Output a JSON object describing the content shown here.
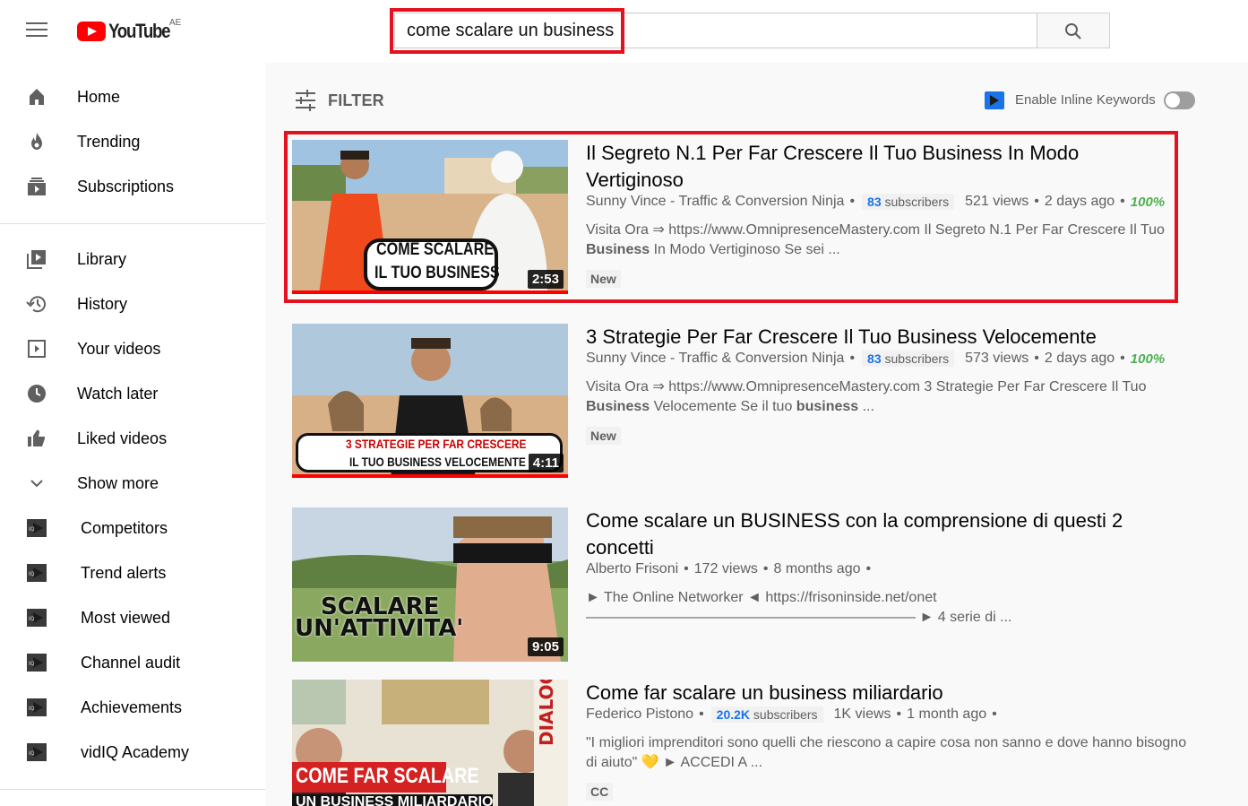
{
  "header": {
    "logo_text": "YouTube",
    "region": "AE",
    "search_query": "come scalare un business"
  },
  "sidebar": {
    "items": [
      {
        "label": "Home",
        "icon": "home-icon"
      },
      {
        "label": "Trending",
        "icon": "trending-icon"
      },
      {
        "label": "Subscriptions",
        "icon": "subscriptions-icon"
      },
      {
        "label": "Library",
        "icon": "library-icon"
      },
      {
        "label": "History",
        "icon": "history-icon"
      },
      {
        "label": "Your videos",
        "icon": "your-videos-icon"
      },
      {
        "label": "Watch later",
        "icon": "watch-later-icon"
      },
      {
        "label": "Liked videos",
        "icon": "liked-videos-icon"
      },
      {
        "label": "Show more",
        "icon": "chevron-down-icon"
      },
      {
        "label": "Competitors",
        "icon": "vidiq-icon"
      },
      {
        "label": "Trend alerts",
        "icon": "vidiq-icon"
      },
      {
        "label": "Most viewed",
        "icon": "vidiq-icon"
      },
      {
        "label": "Channel audit",
        "icon": "vidiq-icon"
      },
      {
        "label": "Achievements",
        "icon": "vidiq-icon"
      },
      {
        "label": "vidIQ Academy",
        "icon": "vidiq-icon"
      }
    ]
  },
  "toolbar": {
    "filter_label": "FILTER",
    "inline_keywords_label": "Enable Inline Keywords"
  },
  "videos": [
    {
      "title": "Il Segreto N.1 Per Far Crescere Il Tuo Business In Modo Vertiginoso",
      "channel": "Sunny Vince - Traffic & Conversion Ninja",
      "subs_count": "83",
      "subs_label": "subscribers",
      "views": "521 views",
      "age": "2 days ago",
      "score": "100%",
      "desc_line1": "Visita Ora ⇒ https://www.OmnipresenceMastery.com Il Segreto N.1 Per Far Crescere Il Tuo",
      "desc_bold": "Business",
      "desc_line2": " In Modo Vertiginoso Se sei ...",
      "badge": "New",
      "duration": "2:53",
      "thumb_line1": "COME SCALARE",
      "thumb_line2": "IL TUO BUSINESS"
    },
    {
      "title": "3 Strategie Per Far Crescere Il Tuo Business Velocemente",
      "channel": "Sunny Vince - Traffic & Conversion Ninja",
      "subs_count": "83",
      "subs_label": "subscribers",
      "views": "573 views",
      "age": "2 days ago",
      "score": "100%",
      "desc_line1": "Visita Ora ⇒ https://www.OmnipresenceMastery.com 3 Strategie Per Far Crescere Il Tuo",
      "desc_bold": "Business",
      "desc_line2": " Velocemente Se il tuo ",
      "desc_bold2": "business",
      "desc_line3": " ...",
      "badge": "New",
      "duration": "4:11",
      "thumb_line1": "3 STRATEGIE PER FAR CRESCERE",
      "thumb_line2": "IL TUO BUSINESS VELOCEMENTE"
    },
    {
      "title": "Come scalare un BUSINESS con la comprensione di questi 2 concetti",
      "channel": "Alberto Frisoni",
      "views": "172 views",
      "age": "8 months ago",
      "desc_line1": "► The Online Networker ◄ https://frisoninside.net/onet",
      "desc_line2": "——————————————————————— ► 4 serie di ...",
      "duration": "9:05",
      "thumb_line1": "SCALARE",
      "thumb_line2": "UN'ATTIVITA'"
    },
    {
      "title": "Come far scalare un business miliardario",
      "channel": "Federico Pistono",
      "subs_count": "20.2K",
      "subs_label": "subscribers",
      "views": "1K views",
      "age": "1 month ago",
      "desc_line1": "\"I migliori imprenditori sono quelli che riescono a capire cosa non sanno e dove hanno bisogno",
      "desc_line2": "di aiuto\" 💛 ► ACCEDI A ...",
      "badge": "CC",
      "thumb_line1": "COME FAR SCALARE",
      "thumb_line2": "UN BUSINESS MILIARDARIO",
      "thumb_side": "DIALOGO"
    }
  ],
  "colors": {
    "highlight": "#e4111f",
    "brand": "#ff0000",
    "score": "#4caf50"
  }
}
